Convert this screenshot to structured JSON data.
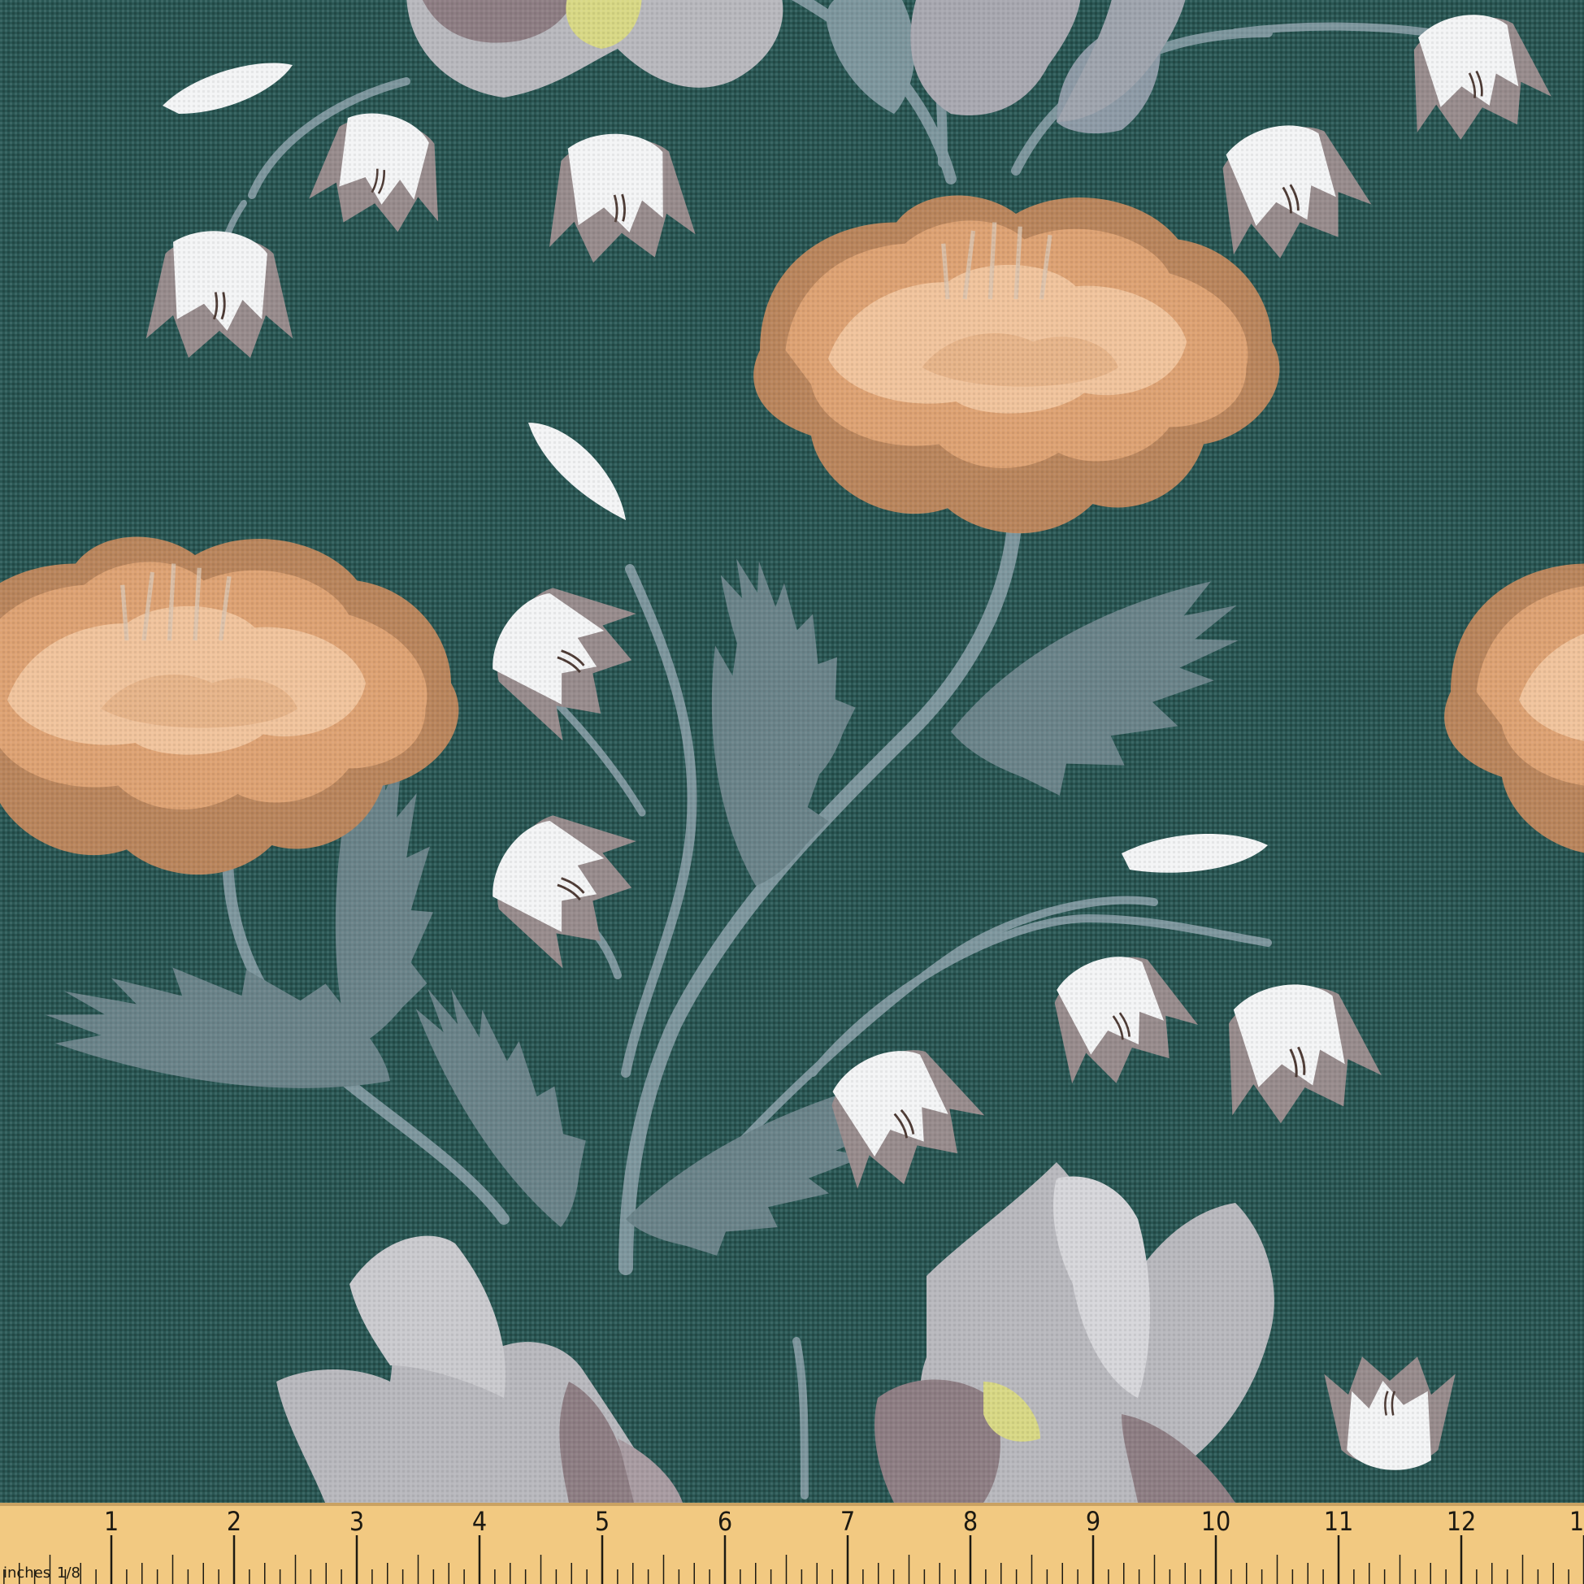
{
  "fabric": {
    "background_color": "#2a5653",
    "flower_colors": {
      "marigold_light": "#f0c39c",
      "marigold_mid": "#dda273",
      "marigold_dark": "#b9855c",
      "bell_white": "#f3f4f5",
      "bell_shadow": "#978b8c",
      "leaf": "#6a8389",
      "stem": "#7d969d",
      "iris_grey": "#b8b8bd",
      "iris_mauve": "#8d7d83",
      "iris_yellow": "#d8d885"
    }
  },
  "ruler": {
    "unit_label": "inches",
    "fraction_label": "1/8",
    "numbers": [
      "1",
      "2",
      "3",
      "4",
      "5",
      "6",
      "7",
      "8",
      "9",
      "10",
      "11",
      "12",
      "1"
    ],
    "background_color": "#f2c981",
    "mark_color": "#1d1a12"
  }
}
